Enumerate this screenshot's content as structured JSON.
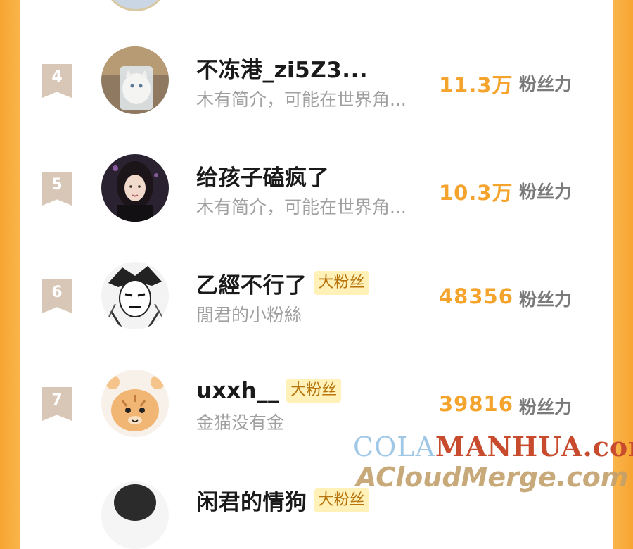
{
  "colors": {
    "accent_orange": "#f4a42c",
    "side_gradient": "#f7a431",
    "rank_ribbon": "#d8c7b6",
    "badge_bg": "#fff1b8",
    "badge_text": "#b8740c"
  },
  "rows": [
    {
      "rank": "4",
      "name": "不冻港_zi5Z3...",
      "badge": "",
      "bio": "木有简介，可能在世界角...",
      "score": "11.3万",
      "unit": "粉丝力",
      "avatar_icon": "cat-in-glass-avatar"
    },
    {
      "rank": "5",
      "name": "给孩子磕疯了",
      "badge": "",
      "bio": "木有简介，可能在世界角...",
      "score": "10.3万",
      "unit": "粉丝力",
      "avatar_icon": "girl-portrait-avatar"
    },
    {
      "rank": "6",
      "name": "乙經不行了",
      "badge": "大粉丝",
      "bio": "閒君的小粉絲",
      "score": "48356",
      "unit": "粉丝力",
      "avatar_icon": "manga-character-avatar"
    },
    {
      "rank": "7",
      "name": "uxxh__",
      "badge": "大粉丝",
      "bio": "金猫没有金",
      "score": "39816",
      "unit": "粉丝力",
      "avatar_icon": "tiger-cartoon-avatar"
    }
  ],
  "partial_row": {
    "name": "闲君的情狗",
    "badge": "大粉丝"
  },
  "watermark": {
    "line1_part1": "COLA",
    "line1_part2": "MANHUA.com",
    "line2": "ACloudMerge.com"
  }
}
